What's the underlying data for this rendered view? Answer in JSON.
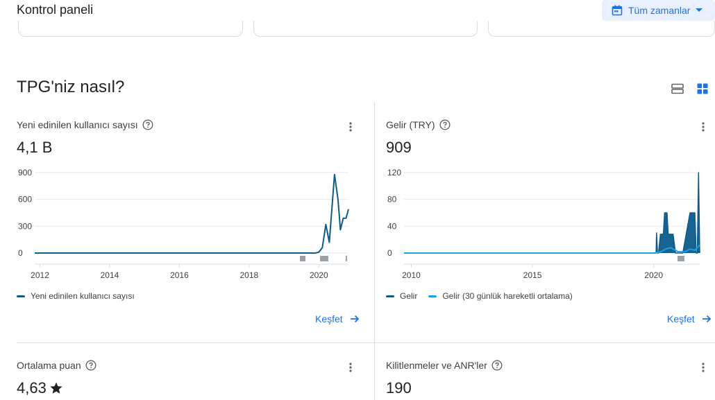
{
  "header": {
    "title": "Kontrol paneli",
    "date_range_label": "Tüm zamanlar"
  },
  "section": {
    "title": "TPG'niz nasıl?"
  },
  "cards": [
    {
      "title": "Yeni edinilen kullanıcı sayısı",
      "value": "4,1 B",
      "legend": [
        "Yeni edinilen kullanıcı sayısı"
      ],
      "explore": "Keşfet"
    },
    {
      "title": "Gelir (TRY)",
      "value": "909",
      "legend": [
        "Gelir",
        "Gelir (30 günlük hareketli ortalama)"
      ],
      "explore": "Keşfet"
    },
    {
      "title": "Ortalama puan",
      "value": "4,63"
    },
    {
      "title": "Kilitlenmeler ve ANR'ler",
      "value": "190"
    }
  ],
  "colors": {
    "accent": "#1a73e8",
    "series_dark": "#0d5b8a",
    "series_light": "#1ba1e2"
  },
  "chart_data": [
    {
      "type": "line",
      "title": "Yeni edinilen kullanıcı sayısı",
      "x_ticks": [
        "2012",
        "2014",
        "2016",
        "2018",
        "2020"
      ],
      "y_ticks": [
        "0",
        "300",
        "600",
        "900"
      ],
      "ylim": [
        0,
        900
      ],
      "xlim": [
        2011.85,
        2020.85
      ],
      "series": [
        {
          "name": "Yeni edinilen kullanıcı sayısı",
          "x": [
            2011.85,
            2019.9,
            2020.0,
            2020.1,
            2020.2,
            2020.3,
            2020.45,
            2020.55,
            2020.62,
            2020.7,
            2020.78,
            2020.85
          ],
          "y": [
            0,
            0,
            10,
            60,
            320,
            120,
            880,
            600,
            260,
            390,
            390,
            490
          ]
        }
      ]
    },
    {
      "type": "area",
      "title": "Gelir (TRY)",
      "x_ticks": [
        "2010",
        "2015",
        "2020"
      ],
      "y_ticks": [
        "0",
        "40",
        "80",
        "120"
      ],
      "ylim": [
        0,
        120
      ],
      "xlim": [
        2009.7,
        2021.9
      ],
      "series": [
        {
          "name": "Gelir",
          "x": [
            2009.7,
            2020.1,
            2020.12,
            2020.16,
            2020.2,
            2020.28,
            2020.4,
            2020.45,
            2020.55,
            2020.6,
            2020.7,
            2020.8,
            2020.9,
            2021.0,
            2021.2,
            2021.5,
            2021.7,
            2021.75,
            2021.8,
            2021.85,
            2021.9
          ],
          "y": [
            0,
            0,
            30,
            0,
            0,
            28,
            28,
            60,
            60,
            28,
            28,
            28,
            0,
            0,
            0,
            60,
            60,
            0,
            0,
            120,
            0
          ]
        },
        {
          "name": "Gelir (30 günlük hareketli ortalama)",
          "x": [
            2009.7,
            2020.0,
            2020.3,
            2020.5,
            2020.7,
            2020.9,
            2021.0,
            2021.3,
            2021.5,
            2021.7,
            2021.9
          ],
          "y": [
            0,
            0,
            2,
            6,
            8,
            4,
            2,
            2,
            6,
            4,
            12
          ]
        }
      ]
    }
  ]
}
